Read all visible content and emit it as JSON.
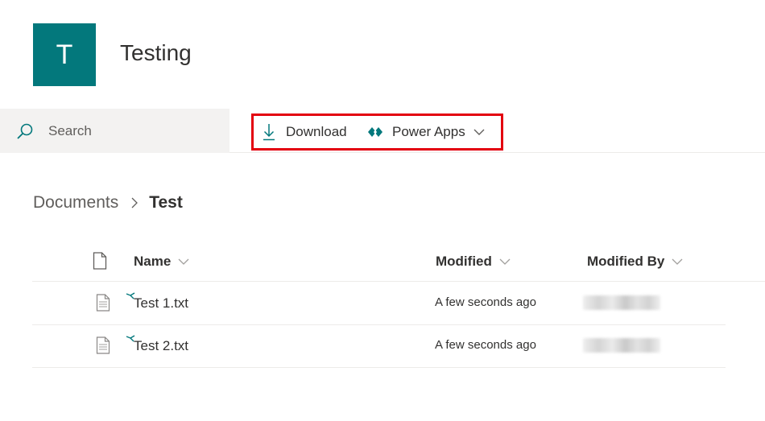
{
  "site": {
    "logo_letter": "T",
    "title": "Testing",
    "logo_color": "#03787c"
  },
  "search": {
    "placeholder": "Search",
    "icon": "search-icon"
  },
  "command_bar": {
    "download_label": "Download",
    "download_icon": "download-icon",
    "powerapps_label": "Power Apps",
    "powerapps_icon": "power-apps-icon",
    "highlight_color": "#e3000f"
  },
  "breadcrumb": {
    "root": "Documents",
    "current": "Test"
  },
  "list": {
    "columns": {
      "name": "Name",
      "modified": "Modified",
      "modified_by": "Modified By"
    },
    "rows": [
      {
        "name": "Test 1.txt",
        "modified": "A few seconds ago",
        "modified_by": ""
      },
      {
        "name": "Test 2.txt",
        "modified": "A few seconds ago",
        "modified_by": ""
      }
    ]
  }
}
